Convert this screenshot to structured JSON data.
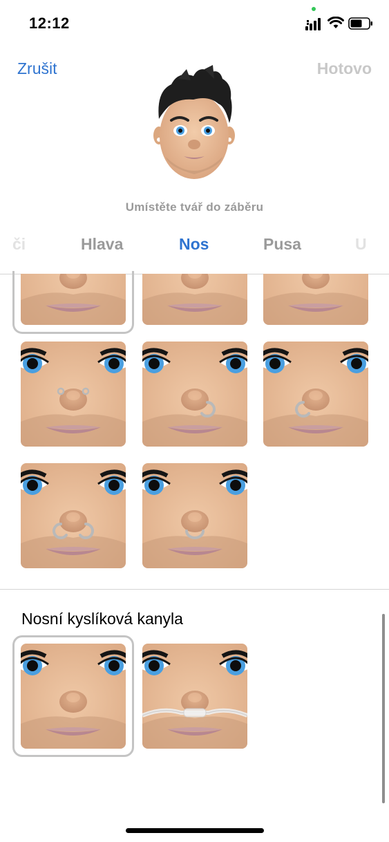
{
  "status_bar": {
    "time": "12:12",
    "icons": [
      "cellular-signal-icon",
      "wifi-icon",
      "battery-icon"
    ],
    "privacy_dot_color": "#34c759"
  },
  "header": {
    "cancel_label": "Zrušit",
    "done_label": "Hotovo",
    "hint": "Umístěte tvář do záběru"
  },
  "tabs": [
    {
      "label": "či",
      "state": "partial"
    },
    {
      "label": "Hlava",
      "state": "inactive"
    },
    {
      "label": "Nos",
      "state": "active"
    },
    {
      "label": "Pusa",
      "state": "inactive"
    },
    {
      "label": "U",
      "state": "partial"
    }
  ],
  "piercing_options": [
    {
      "variant": "plain",
      "selected": true
    },
    {
      "variant": "plain",
      "selected": false
    },
    {
      "variant": "plain",
      "selected": false
    },
    {
      "variant": "bridge-studs",
      "selected": false
    },
    {
      "variant": "right-nostril-ring",
      "selected": false
    },
    {
      "variant": "left-nostril-ring",
      "selected": false
    },
    {
      "variant": "both-nostril-rings",
      "selected": false
    },
    {
      "variant": "septum-ring",
      "selected": false
    }
  ],
  "cannula_section": {
    "title": "Nosní kyslíková kanyla",
    "options": [
      {
        "variant": "none",
        "selected": true
      },
      {
        "variant": "oxygen-cannula",
        "selected": false
      }
    ]
  },
  "colors": {
    "accent": "#2f74d0",
    "disabled": "#c8c8c8",
    "skin": "#e8c09c",
    "iris": "#4a9fe0"
  }
}
